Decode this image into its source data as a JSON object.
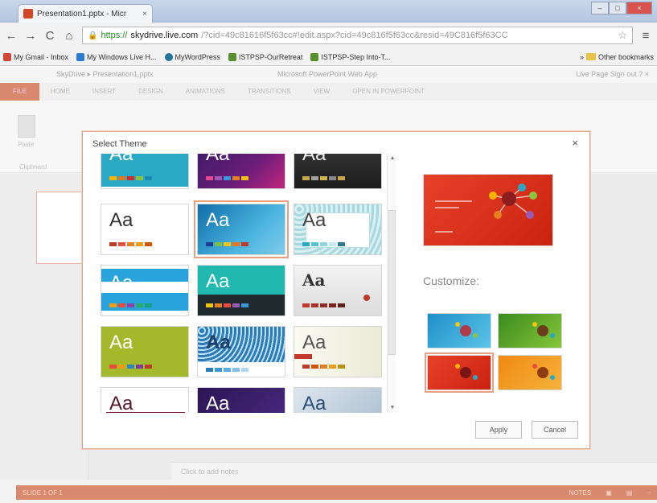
{
  "browser": {
    "tab_title": "Presentation1.pptx - Micr",
    "tab_close": "×",
    "back_glyph": "←",
    "forward_glyph": "→",
    "reload_glyph": "C",
    "home_glyph": "⌂",
    "url_scheme": "https://",
    "url_host": "skydrive.live.com",
    "url_path": "/?cid=49c81616f5f63cc#!edit.aspx?cid=49c816f5f63cc&resid=49C816f5f63CC",
    "star_glyph": "☆",
    "menu_glyph": "≡",
    "window_buttons": [
      "–",
      "□",
      "×"
    ],
    "bookmarks": [
      {
        "label": "My Gmail - Inbox",
        "color": "#d14836"
      },
      {
        "label": "My Windows Live H...",
        "color": "#2b7bd6"
      },
      {
        "label": "MyWordPress",
        "color": "#21759b"
      },
      {
        "label": "ISTPSP-OurRetreat",
        "color": "#5a8f2e"
      },
      {
        "label": "ISTPSP-Step Into-T...",
        "color": "#5a8f2e"
      }
    ],
    "other_bookmarks": "Other bookmarks",
    "other_bookmarks_arrow": "»"
  },
  "app": {
    "crumb": "SkyDrive ▸ Presentation1.pptx",
    "center_title": "Microsoft PowerPoint Web App",
    "right_links": "Live Page   Sign out   ?   ×",
    "ribbon_tabs": [
      "FILE",
      "HOME",
      "INSERT",
      "DESIGN",
      "ANIMATIONS",
      "TRANSITIONS",
      "VIEW",
      "OPEN IN POWERPOINT"
    ],
    "paste_label": "Paste",
    "clipboard_label": "Clipboard",
    "notes_placeholder": "Click to add notes",
    "status_left": "SLIDE 1 OF 1",
    "status_right": [
      "NOTES",
      "▣",
      "▤",
      "−"
    ]
  },
  "dialog": {
    "title": "Select Theme",
    "close": "×",
    "scroll_up": "▲",
    "scroll_down": "▼",
    "sample_glyph": "Aa",
    "themes": [
      {
        "id": "teal-top"
      },
      {
        "id": "purple-wave"
      },
      {
        "id": "dark-gray"
      },
      {
        "id": "office-white"
      },
      {
        "id": "blue-gradient",
        "selected": true
      },
      {
        "id": "teal-pattern"
      },
      {
        "id": "blue-bands"
      },
      {
        "id": "teal-black"
      },
      {
        "id": "gray-serif"
      },
      {
        "id": "lime-green"
      },
      {
        "id": "blue-circles"
      },
      {
        "id": "cream-stripe"
      },
      {
        "id": "white-maroon"
      },
      {
        "id": "purple-dark"
      },
      {
        "id": "blue-gray-swirl"
      }
    ],
    "customize_label": "Customize:",
    "variants": [
      {
        "id": "blue"
      },
      {
        "id": "green"
      },
      {
        "id": "red",
        "selected": true
      },
      {
        "id": "orange"
      }
    ],
    "apply_label": "Apply",
    "cancel_label": "Cancel"
  }
}
